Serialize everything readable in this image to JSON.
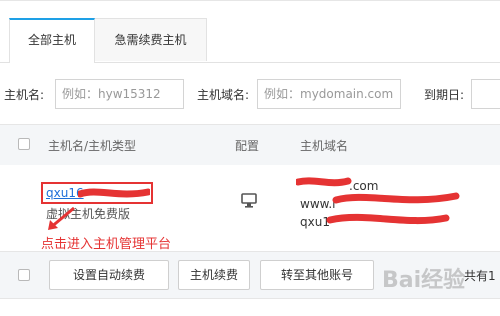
{
  "tabs": [
    {
      "label": "全部主机",
      "active": true
    },
    {
      "label": "急需续费主机",
      "active": false
    }
  ],
  "filters": {
    "host_name_label": "主机名:",
    "host_name_placeholder": "例如：hyw15312",
    "domain_label": "主机域名:",
    "domain_placeholder": "例如：mydomain.com",
    "expire_label": "到期日:"
  },
  "table": {
    "headers": {
      "name_type": "主机名/主机类型",
      "config": "配置",
      "domain": "主机域名"
    },
    "row": {
      "host_name": "qxu16",
      "host_type": "虚拟主机免费版",
      "config_icon": "monitor-icon",
      "domains": [
        ".com",
        "www.l",
        "qxu1"
      ]
    }
  },
  "annotation": "点击进入主机管理平台",
  "actions": {
    "auto_renew": "设置自动续费",
    "renew": "主机续费",
    "transfer": "转至其他账号"
  },
  "total_label": "共有1",
  "watermark": "Bai经验",
  "colors": {
    "accent": "#1ea0e6",
    "annotation_red": "#e53333",
    "link": "#1e6fd9"
  }
}
